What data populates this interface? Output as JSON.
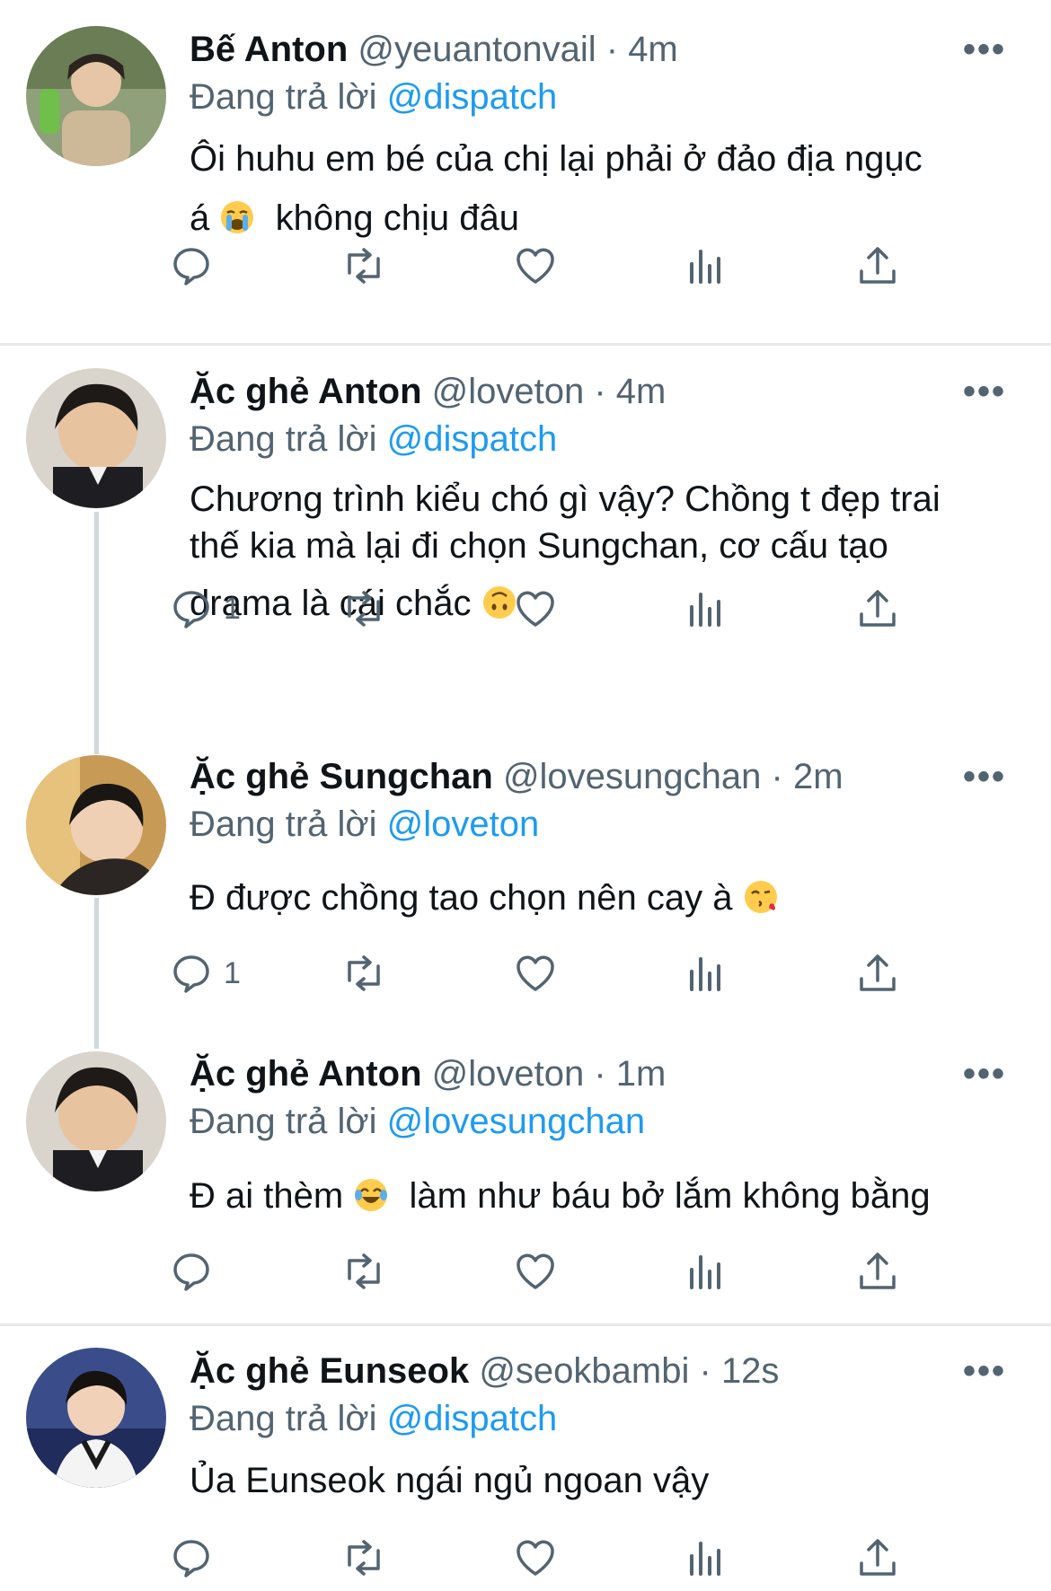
{
  "replying_prefix": "Đang trả lời ",
  "tweets": [
    {
      "name": "Bế Anton",
      "handle": "@yeuantonvail",
      "time": "4m",
      "reply_to": "@dispatch",
      "lines": [
        "Ôi huhu em bé của chị lại phải ở đảo địa ngục",
        "á",
        "không chịu đâu"
      ],
      "emoji": "loudly-crying-face",
      "reply_count": ""
    },
    {
      "name": "Ặc ghẻ Anton",
      "handle": "@loveton",
      "time": "4m",
      "reply_to": "@dispatch",
      "lines": [
        "Chương trình kiểu chó gì vậy? Chồng t đẹp trai",
        "thế kia mà lại đi chọn Sungchan, cơ cấu tạo",
        "drama là cái chắc"
      ],
      "emoji": "upside-down-face",
      "reply_count": "1"
    },
    {
      "name": "Ặc ghẻ Sungchan",
      "handle": "@lovesungchan",
      "time": "2m",
      "reply_to": "@loveton",
      "lines": [
        "Đ được chồng tao chọn nên cay à"
      ],
      "emoji": "face-blowing-kiss",
      "reply_count": "1"
    },
    {
      "name": "Ặc ghẻ Anton",
      "handle": "@loveton",
      "time": "1m",
      "reply_to": "@lovesungchan",
      "lines": [
        "Đ ai thèm",
        "làm như báu bở lắm không bằng"
      ],
      "emoji": "tears-of-joy-face",
      "reply_count": ""
    },
    {
      "name": "Ặc ghẻ Eunseok",
      "handle": "@seokbambi",
      "time": "12s",
      "reply_to": "@dispatch",
      "lines": [
        "Ủa Eunseok ngái ngủ ngoan vậy"
      ],
      "emoji": "",
      "reply_count": ""
    }
  ],
  "icons": {
    "more": "more-dots-icon",
    "reply": "reply-bubble-icon",
    "retweet": "retweet-icon",
    "like": "heart-icon",
    "views": "views-bar-chart-icon",
    "share": "share-upload-icon"
  },
  "colors": {
    "link": "#1d9bf0",
    "muted": "#536471",
    "divider": "#e7e9ea"
  }
}
